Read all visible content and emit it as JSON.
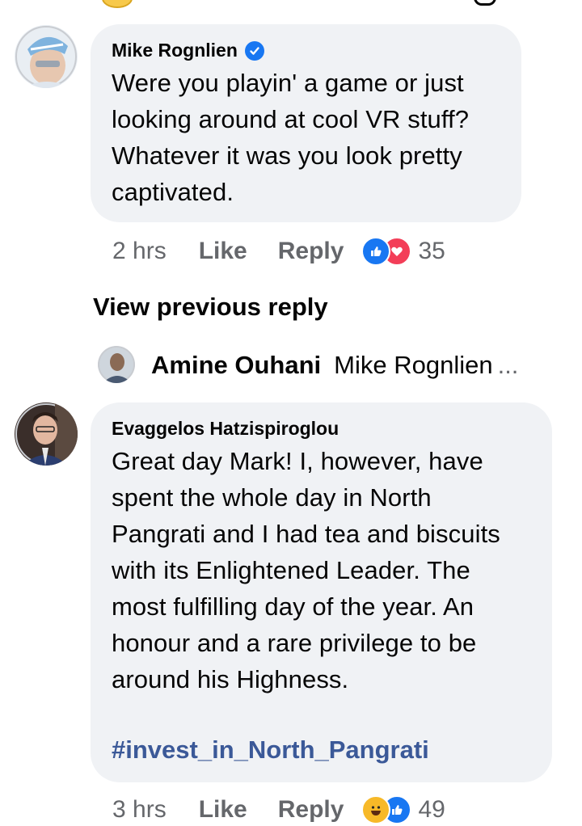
{
  "comments": [
    {
      "author": "Mike Rognlien",
      "verified": true,
      "text_lines": [
        "Were you playin' a game or just",
        "looking around at cool VR stuff?",
        "Whatever it was you look pretty",
        "captivated."
      ],
      "time": "2 hrs",
      "like_label": "Like",
      "reply_label": "Reply",
      "reactions": [
        "like-icon",
        "love-icon"
      ],
      "reaction_count": "35"
    },
    {
      "author": "Evaggelos Hatzispiroglou",
      "verified": false,
      "text_lines": [
        "Great day Mark! I, however, have",
        "spent the whole day in North",
        "Pangrati and I had tea and biscuits",
        "with its Enlightened Leader. The",
        "most fulfilling day of the year. An",
        "honour and a rare privilege to be",
        "around his Highness."
      ],
      "hashtag": "#invest_in_North_Pangrati",
      "time": "3 hrs",
      "like_label": "Like",
      "reply_label": "Reply",
      "reactions": [
        "haha-icon",
        "like-icon"
      ],
      "reaction_count": "49"
    }
  ],
  "replies_section": {
    "view_previous_label": "View previous reply",
    "reply_author": "Amine Ouhani",
    "reply_snippet": "Mike Rognlien",
    "reply_ellipsis": "..."
  },
  "colors": {
    "bubble_bg": "#f0f2f5",
    "meta_gray": "#65676b",
    "verified_blue": "#1877f2",
    "like_blue": "#1877f2",
    "love_red": "#f33e58",
    "haha_yellow": "#f7b928",
    "hashtag_blue": "#3b5998"
  }
}
